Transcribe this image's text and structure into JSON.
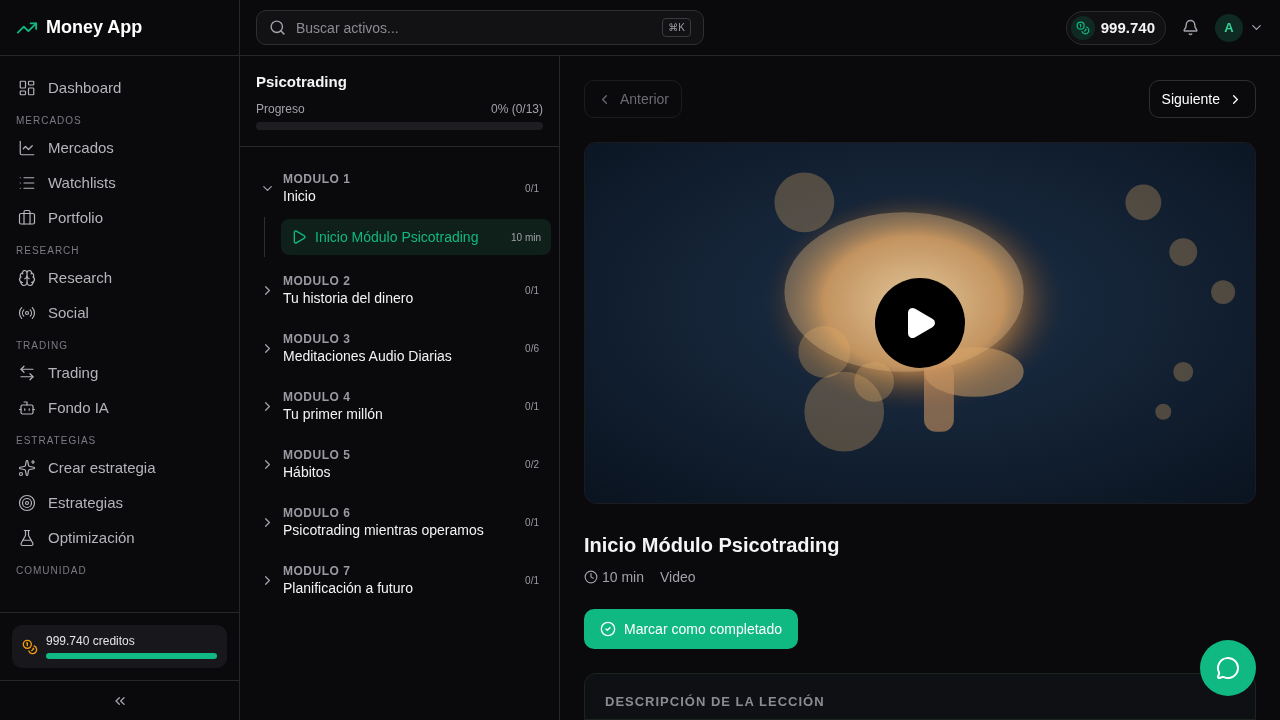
{
  "app": {
    "name": "Money App"
  },
  "sidebar": {
    "sections": [
      {
        "items": [
          {
            "label": "Dashboard"
          }
        ]
      },
      {
        "label": "MERCADOS",
        "items": [
          {
            "label": "Mercados"
          },
          {
            "label": "Watchlists"
          },
          {
            "label": "Portfolio"
          }
        ]
      },
      {
        "label": "RESEARCH",
        "items": [
          {
            "label": "Research"
          },
          {
            "label": "Social"
          }
        ]
      },
      {
        "label": "TRADING",
        "items": [
          {
            "label": "Trading"
          },
          {
            "label": "Fondo IA"
          }
        ]
      },
      {
        "label": "ESTRATEGIAS",
        "items": [
          {
            "label": "Crear estrategia"
          },
          {
            "label": "Estrategias"
          },
          {
            "label": "Optimización"
          }
        ]
      },
      {
        "label": "COMUNIDAD"
      }
    ],
    "credits": {
      "text": "999.740 creditos",
      "level": 1
    }
  },
  "topbar": {
    "search": {
      "placeholder": "Buscar activos...",
      "shortcut": "⌘K"
    },
    "balance": "999.740",
    "avatar": "A"
  },
  "course": {
    "title": "Psicotrading",
    "progress_label": "Progreso",
    "progress_text": "0% (0/13)",
    "level": 0,
    "modules": [
      {
        "number": "MODULO 1",
        "title": "Inicio",
        "count": "0/1",
        "expanded": true,
        "children": [
          {
            "title": "Inicio Módulo Psicotrading",
            "duration": "10 min",
            "selected": true
          }
        ]
      },
      {
        "number": "MODULO 2",
        "title": "Tu historia del dinero",
        "count": "0/1",
        "expanded": false
      },
      {
        "number": "MODULO 3",
        "title": "Meditaciones Audio Diarias",
        "count": "0/6",
        "expanded": false
      },
      {
        "number": "MODULO 4",
        "title": "Tu primer millón",
        "count": "0/1",
        "expanded": false
      },
      {
        "number": "MODULO 5",
        "title": "Hábitos",
        "count": "0/2",
        "expanded": false
      },
      {
        "number": "MODULO 6",
        "title": "Psicotrading mientras operamos",
        "count": "0/1",
        "expanded": false
      },
      {
        "number": "MODULO 7",
        "title": "Planificación a futuro",
        "count": "0/1",
        "expanded": false
      }
    ]
  },
  "lesson": {
    "prev": {
      "label": "Anterior",
      "disabled": true
    },
    "next": {
      "label": "Siguiente",
      "disabled": false
    },
    "title": "Inicio Módulo Psicotrading",
    "duration": "10 min",
    "type": "Video",
    "complete_button": "Marcar como completado",
    "description_heading": "DESCRIPCIÓN DE LA LECCIÓN"
  }
}
